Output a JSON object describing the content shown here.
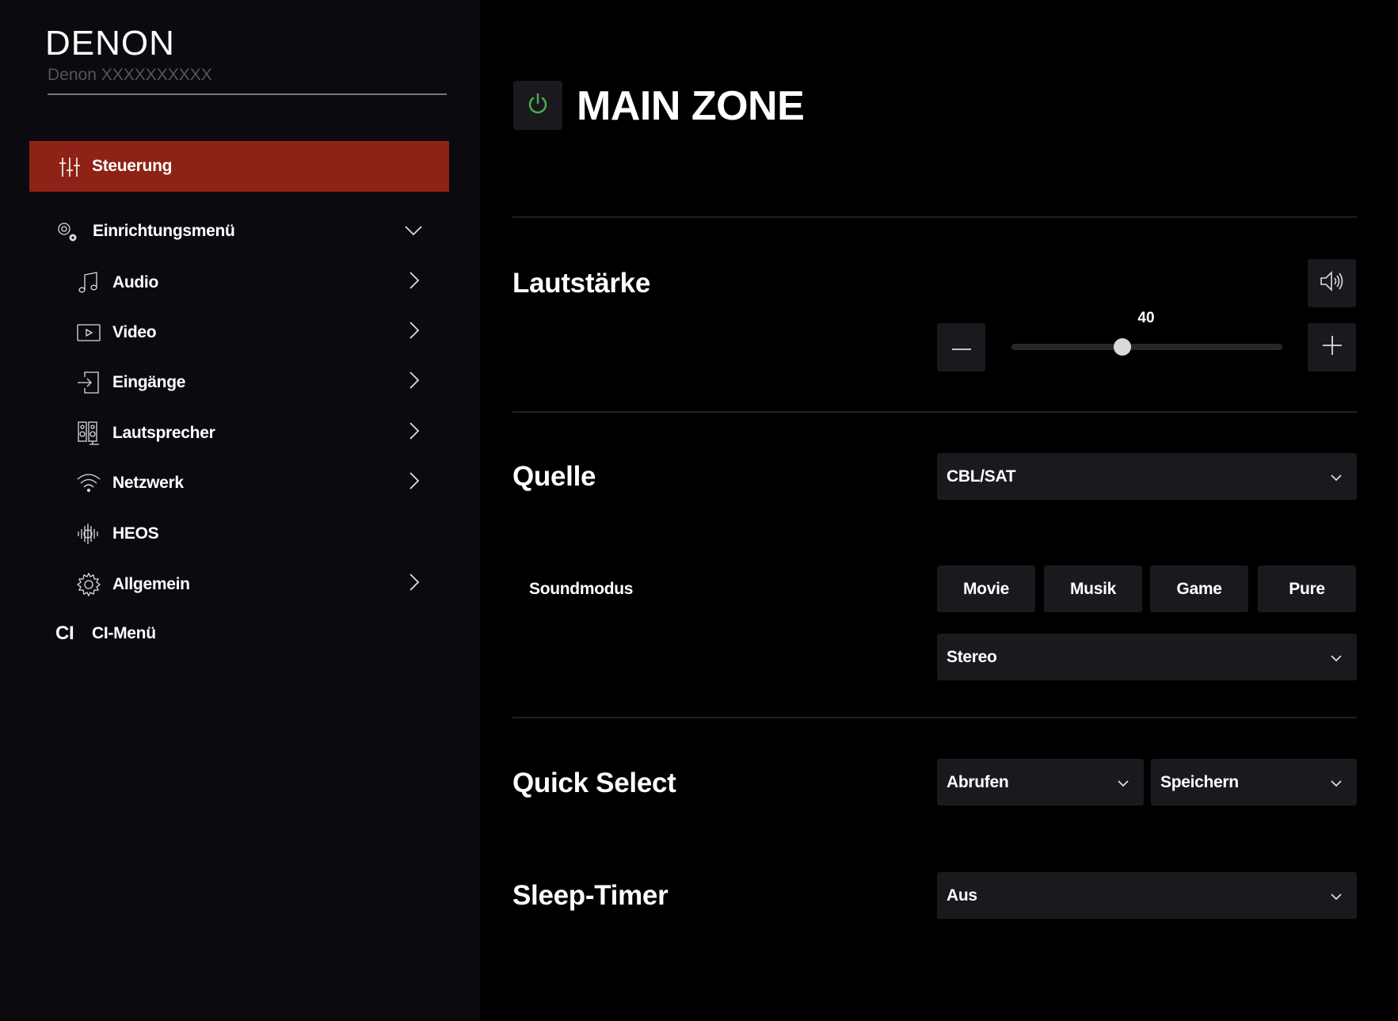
{
  "sidebar": {
    "brand": "DENON",
    "device_name": "Denon XXXXXXXXXX",
    "active_item": {
      "label": "Steuerung",
      "icon": "sliders-icon"
    },
    "setup_menu": {
      "label": "Einrichtungsmenü",
      "icon": "gears-icon",
      "expanded": true
    },
    "items": [
      {
        "label": "Audio",
        "icon": "music-note-icon",
        "has_submenu": true
      },
      {
        "label": "Video",
        "icon": "video-play-icon",
        "has_submenu": true
      },
      {
        "label": "Eingänge",
        "icon": "input-icon",
        "has_submenu": true
      },
      {
        "label": "Lautsprecher",
        "icon": "speakers-icon",
        "has_submenu": true
      },
      {
        "label": "Netzwerk",
        "icon": "wifi-icon",
        "has_submenu": true
      },
      {
        "label": "HEOS",
        "icon": "heos-icon",
        "has_submenu": false
      },
      {
        "label": "Allgemein",
        "icon": "gear-icon",
        "has_submenu": true
      }
    ],
    "ci_menu": {
      "glyph": "CI",
      "label": "CI-Menü"
    }
  },
  "main": {
    "title": "MAIN ZONE",
    "power_icon_color": "#4caf50",
    "volume": {
      "label": "Lautstärke",
      "value": "40",
      "level_fraction": 0.41
    },
    "source": {
      "label": "Quelle",
      "selected": "CBL/SAT"
    },
    "sound_mode": {
      "label": "Soundmodus",
      "buttons": [
        "Movie",
        "Musik",
        "Game",
        "Pure"
      ],
      "selected": "Stereo"
    },
    "quick_select": {
      "label": "Quick Select",
      "recall": "Abrufen",
      "save": "Speichern"
    },
    "sleep_timer": {
      "label": "Sleep-Timer",
      "selected": "Aus"
    }
  },
  "colors": {
    "active_nav": "#8f2216",
    "sidebar_bg": "#0b0a0f",
    "main_bg": "#000000",
    "control_bg": "#1a1a1e"
  }
}
